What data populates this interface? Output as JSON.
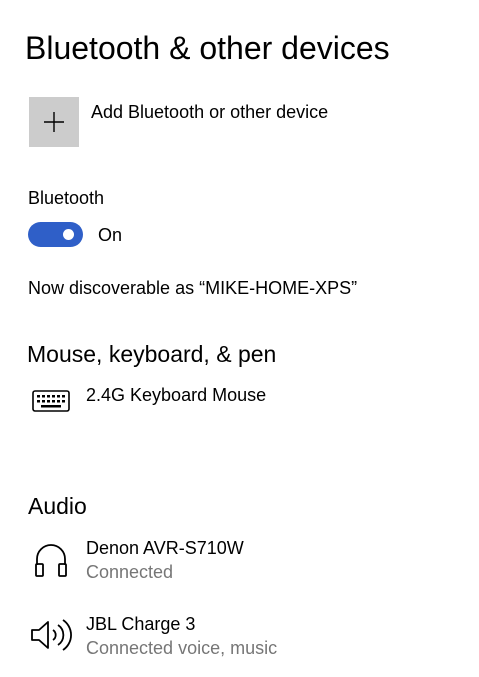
{
  "page": {
    "title": "Bluetooth & other devices"
  },
  "add_device": {
    "label": "Add Bluetooth or other device",
    "icon": "plus-icon"
  },
  "bluetooth": {
    "label": "Bluetooth",
    "toggle_state": "On",
    "toggle_color": "#2f5fc8",
    "discoverable_text": "Now discoverable as “MIKE-HOME-XPS”"
  },
  "sections": {
    "input": {
      "title": "Mouse, keyboard, & pen",
      "devices": [
        {
          "name": "2.4G Keyboard Mouse",
          "icon": "keyboard-icon"
        }
      ]
    },
    "audio": {
      "title": "Audio",
      "devices": [
        {
          "name": "Denon AVR-S710W",
          "status": "Connected",
          "icon": "headphones-icon"
        },
        {
          "name": "JBL Charge 3",
          "status": "Connected voice, music",
          "icon": "speaker-icon"
        }
      ]
    }
  }
}
